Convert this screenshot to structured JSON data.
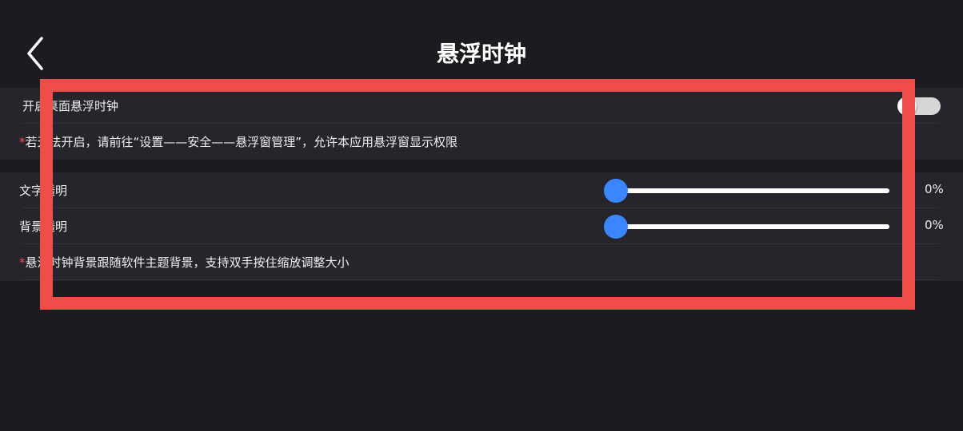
{
  "header": {
    "title": "悬浮时钟"
  },
  "enable_group": {
    "enable_label": "开启桌面悬浮时钟",
    "enable_on": false,
    "note_star": "*",
    "note_text": "若无法开启，请前往“设置——安全——悬浮窗管理”，允许本应用悬浮窗显示权限"
  },
  "opacity_group": {
    "text_label": "文字透明",
    "text_value": 0,
    "text_percent": "0%",
    "bg_label": "背景透明",
    "bg_value": 0,
    "bg_percent": "0%",
    "note_star": "*",
    "note_text": "悬浮时钟背景跟随软件主题背景，支持双手按住缩放调整大小"
  },
  "colors": {
    "accent": "#3a86ff",
    "highlight": "#ef4c4a",
    "background": "#1c1c20",
    "group_background": "#25252b",
    "note_star": "#ff4d4d"
  },
  "icons": {
    "back": "chevron-left-icon"
  }
}
